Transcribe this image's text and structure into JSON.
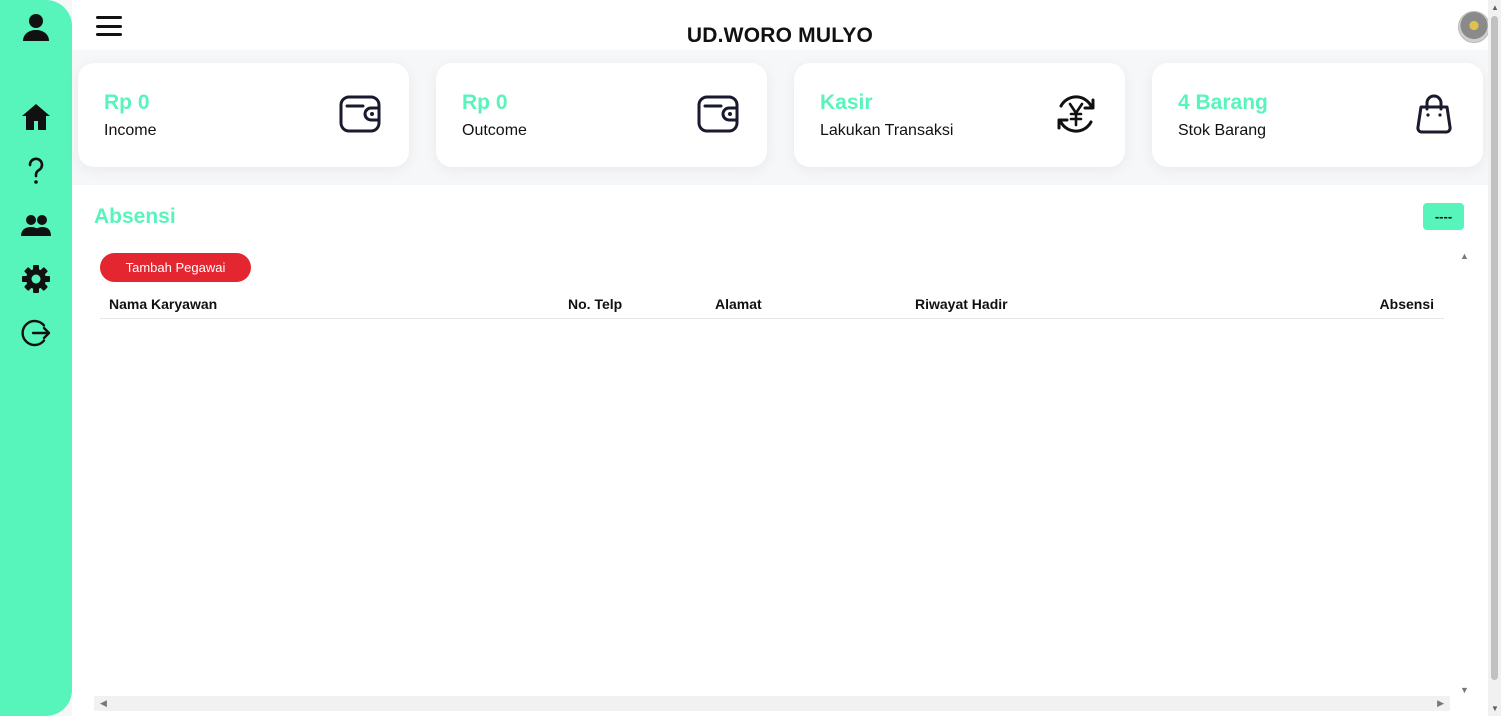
{
  "header": {
    "title": "UD.WORO MULYO"
  },
  "cards": [
    {
      "value": "Rp 0",
      "label": "Income",
      "icon": "wallet-icon"
    },
    {
      "value": "Rp 0",
      "label": "Outcome",
      "icon": "wallet-icon"
    },
    {
      "value": "Kasir",
      "label": "Lakukan Transaksi",
      "icon": "currency-exchange-icon"
    },
    {
      "value": "4 Barang",
      "label": "Stok Barang",
      "icon": "shopping-bag-icon"
    }
  ],
  "sidebar": {
    "items": [
      {
        "icon": "user-icon"
      },
      {
        "icon": "home-icon"
      },
      {
        "icon": "help-icon"
      },
      {
        "icon": "users-icon"
      },
      {
        "icon": "gear-icon"
      },
      {
        "icon": "logout-icon"
      }
    ]
  },
  "absensi": {
    "title": "Absensi",
    "menu_button": "----",
    "add_button": "Tambah Pegawai",
    "columns": [
      "Nama Karyawan",
      "No. Telp",
      "Alamat",
      "Riwayat Hadir",
      "Absensi"
    ],
    "rows": []
  },
  "colors": {
    "accent": "#57f4bc",
    "danger": "#e3262f"
  }
}
